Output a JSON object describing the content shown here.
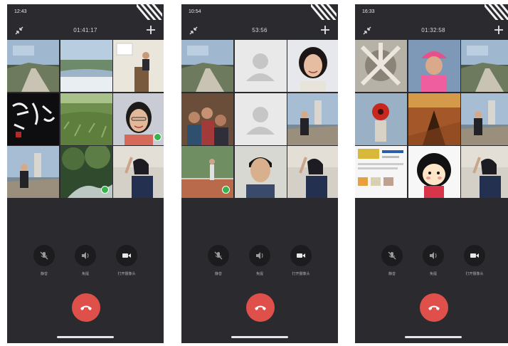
{
  "phones": [
    {
      "status_time": "12:43",
      "status_right": "",
      "call_timer": "01:41:17",
      "tiles": [
        "landscape-river",
        "waterfall-falls",
        "presenter-podium",
        "calligraphy-art",
        "green-field",
        "woman-glasses-smiling",
        "man-by-lighthouse",
        "forest-stream",
        "woman-selfie"
      ],
      "mic_on": [
        5,
        7
      ]
    },
    {
      "status_time": "10:54",
      "status_right": "",
      "call_timer": "53:56",
      "tiles": [
        "landscape-river",
        "placeholder-avatar",
        "woman-portrait",
        "group-photo",
        "placeholder-avatar",
        "man-by-lighthouse",
        "tennis-court",
        "young-man-portrait",
        "woman-selfie"
      ],
      "mic_on": [
        6
      ]
    },
    {
      "status_time": "16:33",
      "status_right": "",
      "call_timer": "01:32:58",
      "tiles": [
        "feet-circle",
        "woman-pink-cap",
        "landscape-river",
        "red-flower",
        "shadow-sunset",
        "man-by-lighthouse",
        "document-page",
        "cartoon-girl",
        "woman-selfie"
      ],
      "mic_on": []
    }
  ],
  "controls": {
    "mute_label": "静音",
    "speaker_label": "免提",
    "camera_label": "打开摄像头"
  },
  "colors": {
    "background": "#2b2b2f",
    "hangup": "#e0504b",
    "mic_badge": "#36b34a"
  }
}
